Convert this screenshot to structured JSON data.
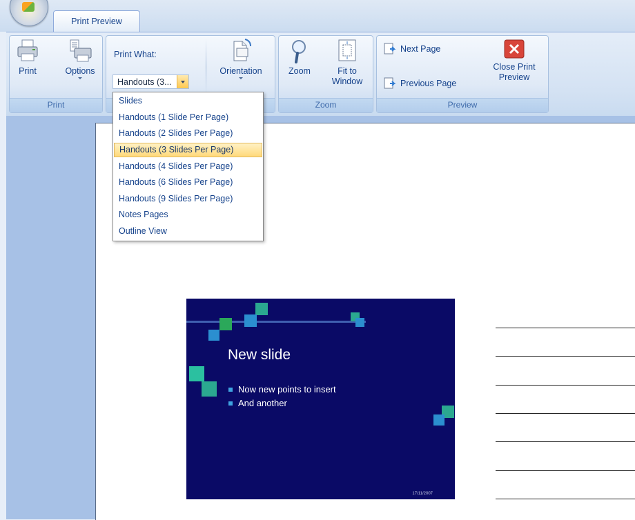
{
  "tabs": {
    "active_label": "Print Preview"
  },
  "ribbon": {
    "groups": {
      "print": {
        "label": "Print",
        "print_button": "Print",
        "options_button": "Options"
      },
      "page_setup": {
        "print_what_label": "Print What:",
        "print_what_value": "Handouts (3...",
        "orientation_button": "Orientation"
      },
      "zoom": {
        "label": "Zoom",
        "zoom_button": "Zoom",
        "fit_line1": "Fit to",
        "fit_line2": "Window"
      },
      "preview": {
        "label": "Preview",
        "next_page": "Next Page",
        "previous_page": "Previous Page",
        "close_line1": "Close Print",
        "close_line2": "Preview"
      }
    }
  },
  "dropdown": {
    "items": [
      "Slides",
      "Handouts (1 Slide Per Page)",
      "Handouts (2 Slides Per Page)",
      "Handouts (3 Slides Per Page)",
      "Handouts (4 Slides Per Page)",
      "Handouts (6 Slides Per Page)",
      "Handouts (9 Slides Per Page)",
      "Notes Pages",
      "Outline View"
    ],
    "selected_index": 3
  },
  "slide": {
    "title": "New slide",
    "bullets": [
      "Now new points to insert",
      "And another"
    ],
    "date": "17/11/2007"
  },
  "colors": {
    "slide_background": "#0a0a66",
    "dropdown_highlight": "#ffd97a",
    "workspace": "#a7c1e6"
  }
}
